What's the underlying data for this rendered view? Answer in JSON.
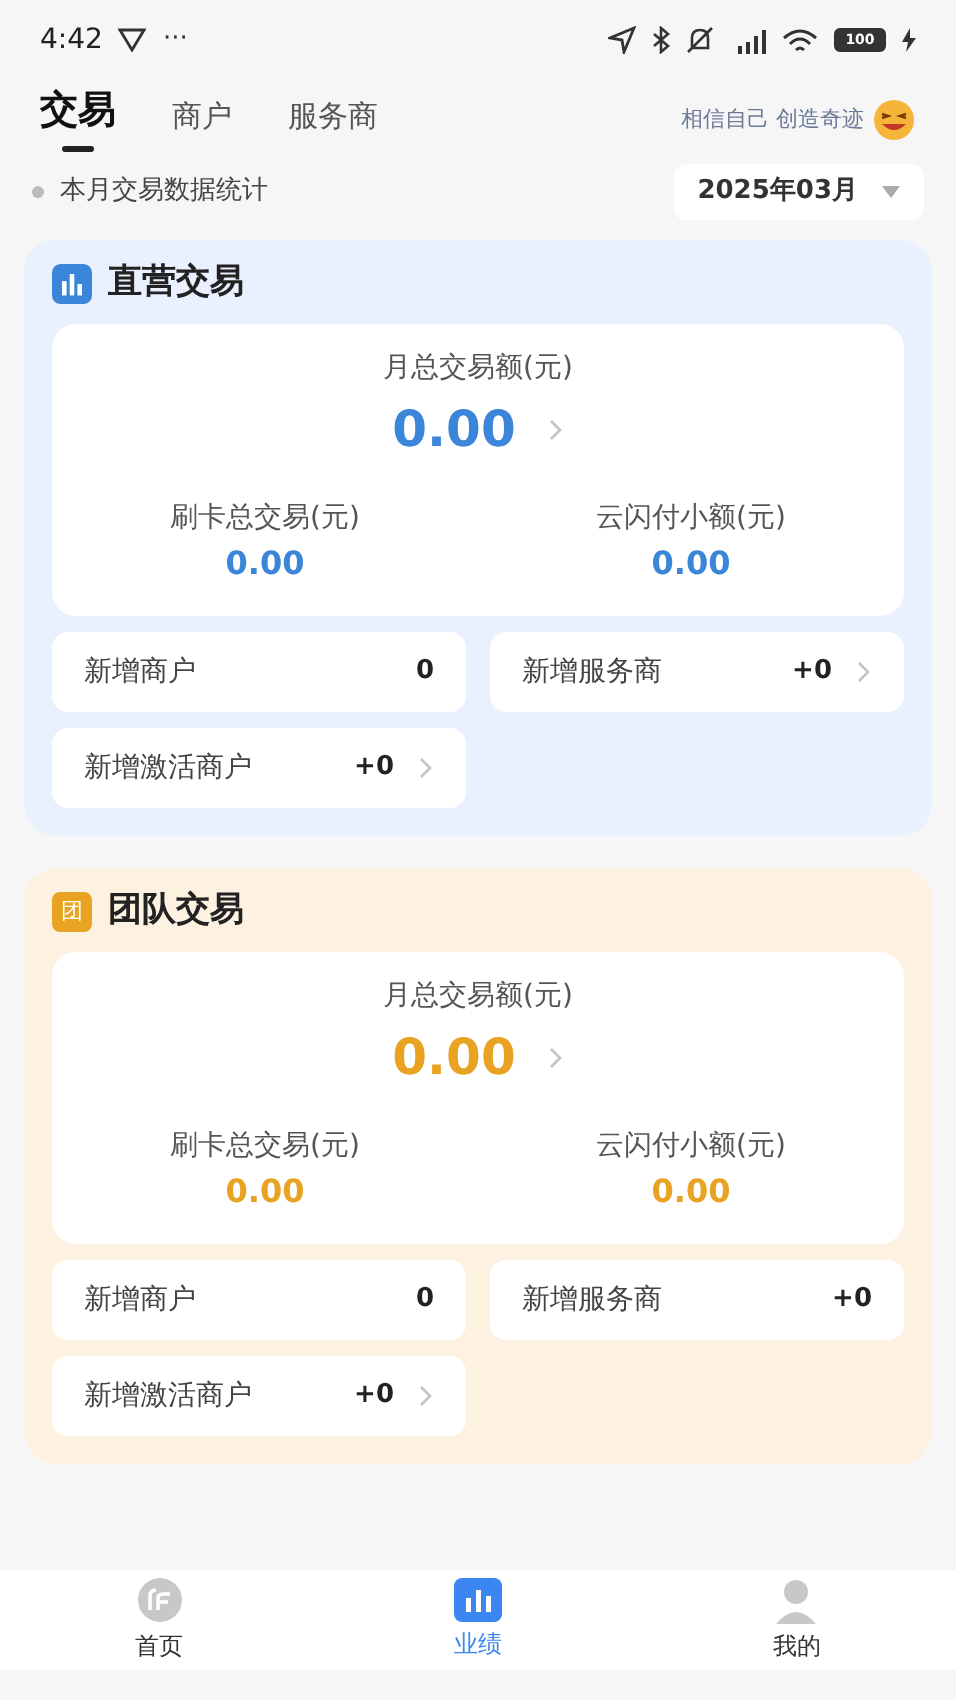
{
  "status_bar": {
    "time": "4:42",
    "dots": "···",
    "battery": "100"
  },
  "tabs": [
    {
      "label": "交易",
      "selected": true
    },
    {
      "label": "商户",
      "selected": false
    },
    {
      "label": "服务商",
      "selected": false
    }
  ],
  "motto": "相信自己 创造奇迹",
  "subtitle": "本月交易数据统计",
  "month_picker": {
    "value": "2025年03月"
  },
  "sections": [
    {
      "title": "直营交易",
      "color": "#3b86d8",
      "kind": "chart",
      "total_label": "月总交易额(元)",
      "total_value": "0.00",
      "sub": [
        {
          "label": "刷卡总交易(元)",
          "value": "0.00"
        },
        {
          "label": "云闪付小额(元)",
          "value": "0.00"
        }
      ],
      "stats": [
        {
          "label": "新增商户",
          "value": "0",
          "chevron": false
        },
        {
          "label": "新增服务商",
          "value": "+0",
          "chevron": true
        },
        {
          "label": "新增激活商户",
          "value": "+0",
          "chevron": true
        }
      ]
    },
    {
      "title": "团队交易",
      "color": "#e9a323",
      "kind": "text",
      "badge_text": "团",
      "total_label": "月总交易额(元)",
      "total_value": "0.00",
      "sub": [
        {
          "label": "刷卡总交易(元)",
          "value": "0.00"
        },
        {
          "label": "云闪付小额(元)",
          "value": "0.00"
        }
      ],
      "stats": [
        {
          "label": "新增商户",
          "value": "0",
          "chevron": false
        },
        {
          "label": "新增服务商",
          "value": "+0",
          "chevron": false
        },
        {
          "label": "新增激活商户",
          "value": "+0",
          "chevron": true
        }
      ]
    }
  ],
  "bottom_nav": [
    {
      "label": "首页",
      "kind": "home",
      "selected": false
    },
    {
      "label": "业绩",
      "kind": "chart",
      "selected": true
    },
    {
      "label": "我的",
      "kind": "person",
      "selected": false
    }
  ]
}
